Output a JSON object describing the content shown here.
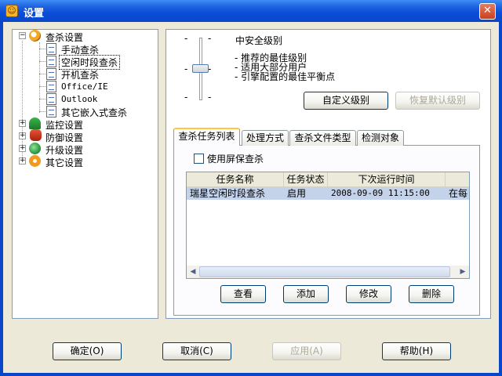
{
  "window": {
    "title": "设置",
    "close_glyph": "✕"
  },
  "tree": {
    "nodes": [
      {
        "label": "查杀设置",
        "icon": "scan-icon",
        "expanded": true
      },
      {
        "label": "手动查杀"
      },
      {
        "label": "空闲时段查杀",
        "selected": true
      },
      {
        "label": "开机查杀"
      },
      {
        "label": "Office/IE"
      },
      {
        "label": "Outlook"
      },
      {
        "label": "其它嵌入式查杀"
      },
      {
        "label": "监控设置",
        "icon": "monitor-umbrella-icon"
      },
      {
        "label": "防御设置",
        "icon": "defense-hand-icon"
      },
      {
        "label": "升级设置",
        "icon": "update-icon"
      },
      {
        "label": "其它设置",
        "icon": "other-settings-gear-icon"
      }
    ]
  },
  "security_level": {
    "title": "中安全级别",
    "descriptions": [
      "- 推荐的最佳级别",
      "- 适用大部分用户",
      "- 引擎配置的最佳平衡点"
    ],
    "tick_label": "-",
    "custom_button": "自定义级别",
    "restore_button": "恢复默认级别"
  },
  "tabs": [
    {
      "label": "查杀任务列表",
      "active": true
    },
    {
      "label": "处理方式"
    },
    {
      "label": "查杀文件类型"
    },
    {
      "label": "检测对象"
    }
  ],
  "screensaver_checkbox": {
    "label": "使用屏保查杀",
    "checked": false
  },
  "task_table": {
    "columns": [
      "任务名称",
      "任务状态",
      "下次运行时间",
      ""
    ],
    "rows": [
      [
        "瑞星空闲时段查杀",
        "启用",
        "2008-09-09  11:15:00",
        "在每"
      ]
    ]
  },
  "task_buttons": {
    "view": "查看",
    "add": "添加",
    "edit": "修改",
    "delete": "删除"
  },
  "footer": {
    "ok": "确定(O)",
    "cancel": "取消(C)",
    "apply": "应用(A)",
    "help": "帮助(H)"
  },
  "colors": {
    "titlebar": "#0a4dd8",
    "face": "#ece9d8",
    "selection": "#c4d3ea",
    "tab_highlight": "#ffc73c"
  }
}
